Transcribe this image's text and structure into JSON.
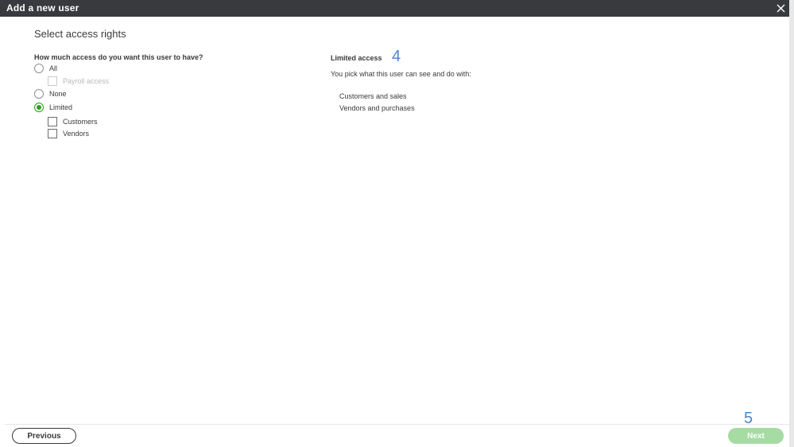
{
  "window": {
    "title": "Add a new user",
    "close_icon": "close-icon"
  },
  "form": {
    "heading": "Select access rights",
    "question": "How much access do you want this user to have?",
    "selected": "Limited",
    "options": {
      "all": "All",
      "payroll": "Payroll access",
      "none": "None",
      "limited": "Limited",
      "customers": "Customers",
      "vendors": "Vendors"
    }
  },
  "panel": {
    "title": "Limited access",
    "description": "You pick what this user can see and do with:",
    "items": [
      "Customers and sales",
      "Vendors and purchases"
    ]
  },
  "annotations": {
    "step4": "4",
    "step5": "5"
  },
  "footer": {
    "previous_label": "Previous",
    "next_label": "Next"
  },
  "colors": {
    "titlebar": "#393a3d",
    "accent_green": "#2ca01c",
    "next_disabled": "#a6dba4",
    "annotation_blue": "#4f86c6"
  }
}
